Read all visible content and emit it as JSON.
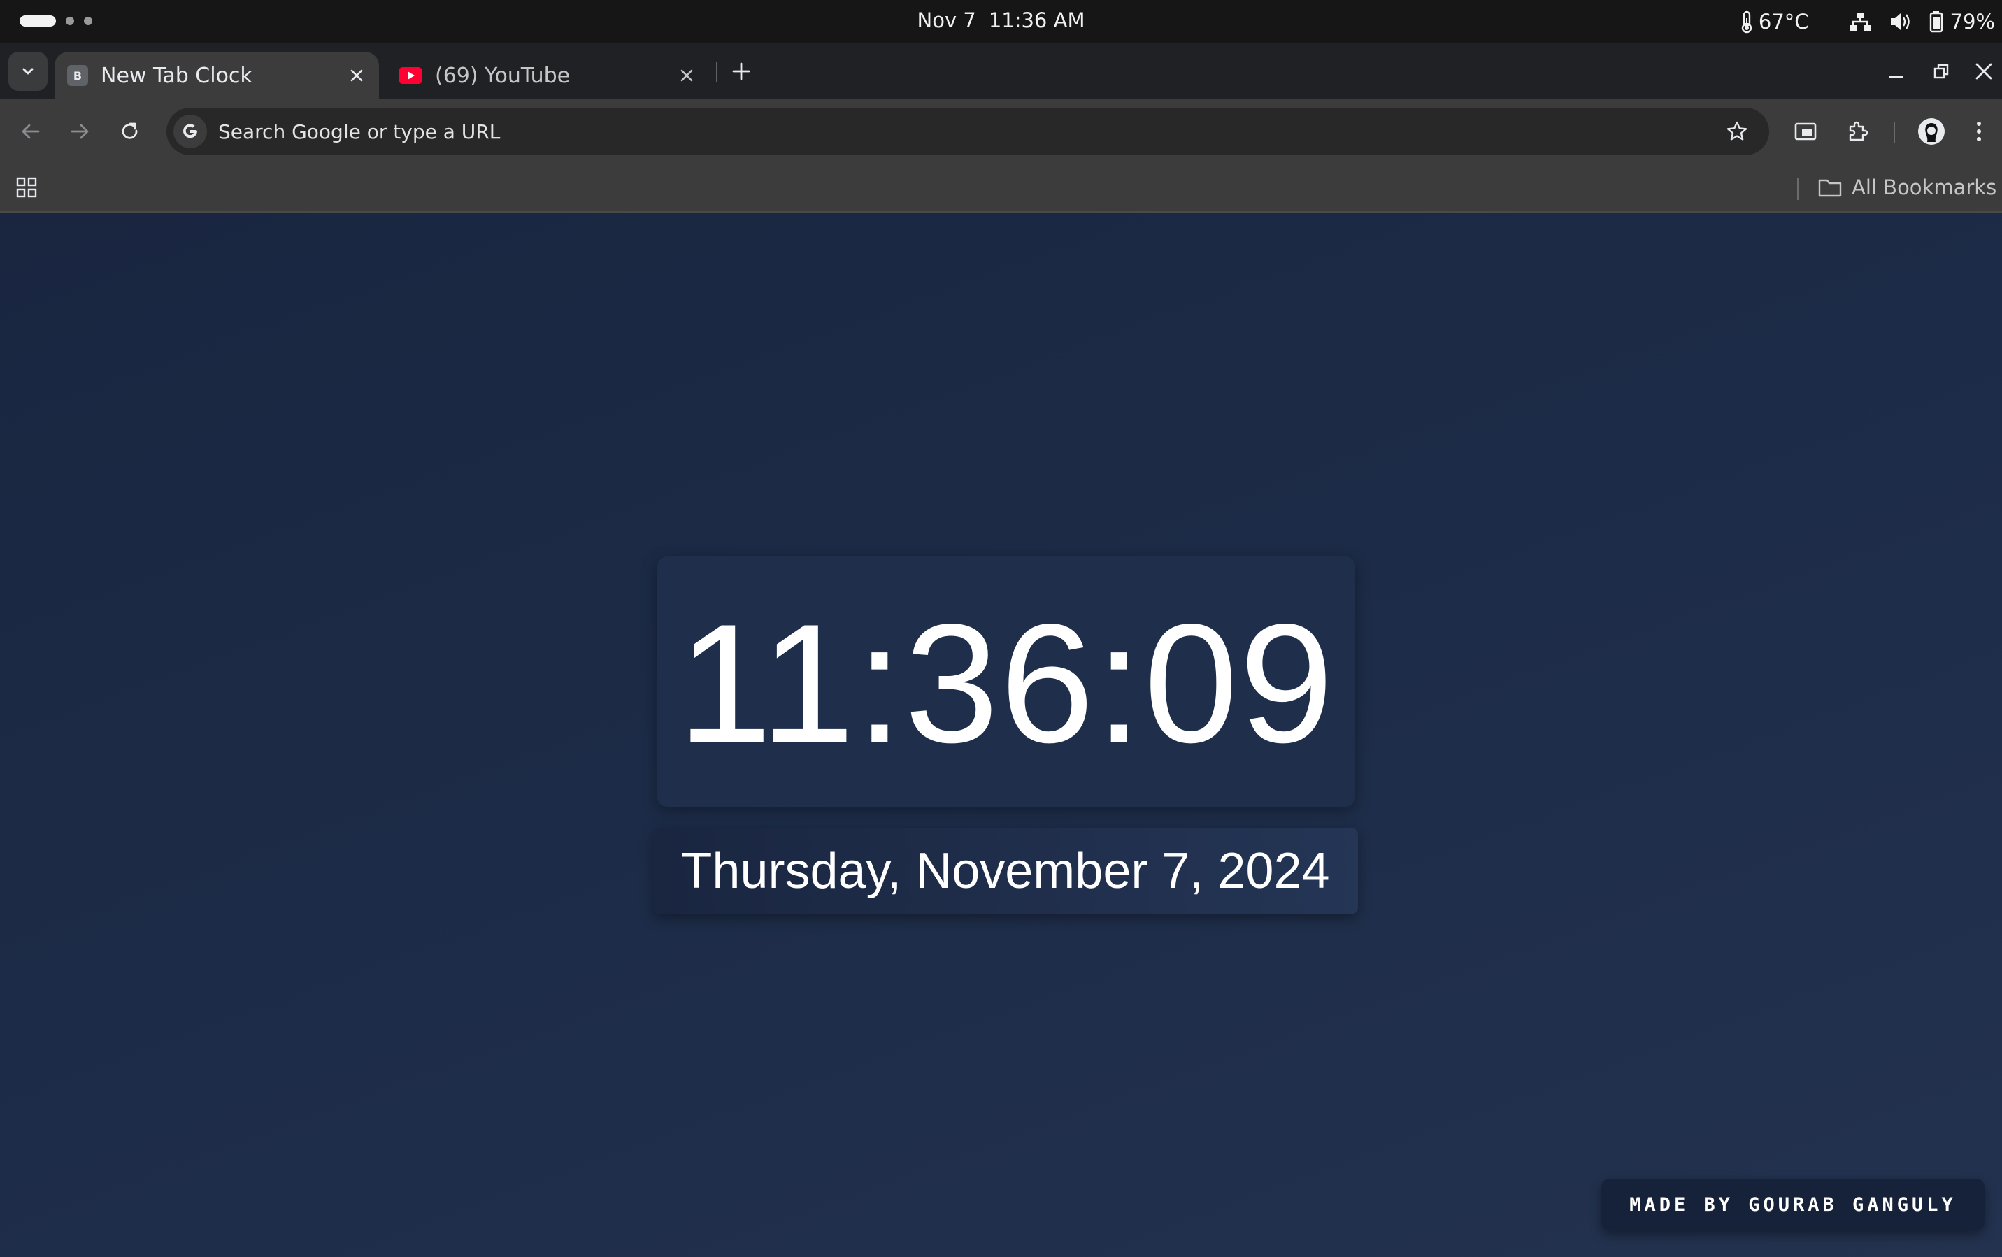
{
  "os_bar": {
    "date": "Nov 7",
    "time": "11:36 AM",
    "temperature": "67°C",
    "battery": "79%"
  },
  "tabs": [
    {
      "title": "New Tab Clock",
      "favicon_letter": "B",
      "active": true
    },
    {
      "title": "(69) YouTube",
      "favicon": "youtube-icon",
      "active": false
    }
  ],
  "toolbar": {
    "omnibox_placeholder": "Search Google or type a URL"
  },
  "bookmarks_bar": {
    "all_bookmarks_label": "All Bookmarks"
  },
  "clock_page": {
    "time": "11:36:09",
    "date": "Thursday, November 7, 2024",
    "credit": "MADE BY GOURAB GANGULY"
  },
  "colors": {
    "page_background": "#1c2b47",
    "clock_card": "#1e2e4b",
    "youtube_red": "#ff0033",
    "browser_frame": "#202124",
    "toolbar": "#3c3c3c"
  }
}
